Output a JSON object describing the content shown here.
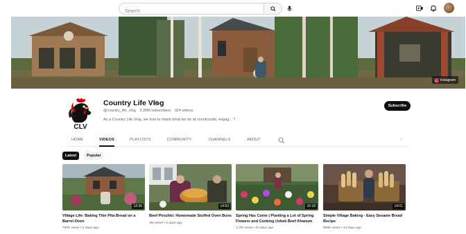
{
  "search": {
    "placeholder": "Search"
  },
  "banner": {
    "social_link": "Instagram"
  },
  "channel": {
    "name": "Country Life Vlog",
    "handle": "@country_life_vlog",
    "subscribers": "3.26M subscribers",
    "videos_count": "324 videos",
    "description": "As a Country Life Vlog, we love to share what we do at countryside, engag...",
    "subscribe_label": "Subscribe",
    "avatar_text": "CLV"
  },
  "tabs": [
    {
      "label": "HOME"
    },
    {
      "label": "VIDEOS"
    },
    {
      "label": "PLAYLISTS"
    },
    {
      "label": "COMMUNITY"
    },
    {
      "label": "CHANNELS"
    },
    {
      "label": "ABOUT"
    }
  ],
  "chips": [
    {
      "label": "Latest"
    },
    {
      "label": "Popular"
    }
  ],
  "videos": [
    {
      "title": "Village Life: Baking Thin Pita Bread on a Barrel-Oven",
      "views": "793K views",
      "age": "3 days ago",
      "duration": "12:36"
    },
    {
      "title": "Beef Pirozhki: Homemade Stuffed Oven Buns",
      "views": "1M views",
      "age": "6 days ago",
      "duration": "14:53"
    },
    {
      "title": "Spring Has Come | Planting a Lot of Spring Flowers and Cooking Uzbek Beef Khanum",
      "views": "1.2M views",
      "age": "10 days ago",
      "duration": "15:18"
    },
    {
      "title": "Simple Village Baking - Easy Sesame Bread Recipe",
      "views": "908K views",
      "age": "13 days ago",
      "duration": "14:01"
    }
  ],
  "colors": {
    "text": "#0f0f0f",
    "secondary": "#606060",
    "accent_red": "#cc0000"
  }
}
